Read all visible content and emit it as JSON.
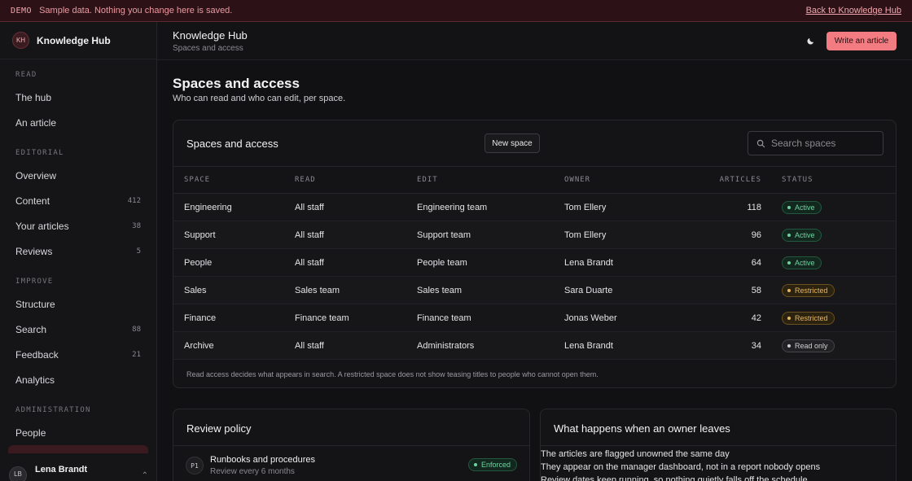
{
  "banner": {
    "tag": "DEMO",
    "message": "Sample data. Nothing you change here is saved.",
    "back_link": "Back to Knowledge Hub"
  },
  "brand": {
    "initials": "KH",
    "name": "Knowledge Hub"
  },
  "sidebar": {
    "sections": [
      {
        "label": "READ",
        "items": [
          {
            "label": "The hub",
            "count": ""
          },
          {
            "label": "An article",
            "count": ""
          }
        ]
      },
      {
        "label": "EDITORIAL",
        "items": [
          {
            "label": "Overview",
            "count": ""
          },
          {
            "label": "Content",
            "count": "412"
          },
          {
            "label": "Your articles",
            "count": "38"
          },
          {
            "label": "Reviews",
            "count": "5"
          }
        ]
      },
      {
        "label": "IMPROVE",
        "items": [
          {
            "label": "Structure",
            "count": ""
          },
          {
            "label": "Search",
            "count": "88"
          },
          {
            "label": "Feedback",
            "count": "21"
          },
          {
            "label": "Analytics",
            "count": ""
          }
        ]
      },
      {
        "label": "ADMINISTRATION",
        "items": [
          {
            "label": "People",
            "count": ""
          }
        ]
      }
    ],
    "user": {
      "initials": "LB",
      "name": "Lena Brandt"
    }
  },
  "header": {
    "title": "Knowledge Hub",
    "subtitle": "Spaces and access",
    "write_label": "Write an article",
    "theme_icon": "moon-icon"
  },
  "page": {
    "title": "Spaces and access",
    "subtitle": "Who can read and who can edit, per space."
  },
  "spaces_card": {
    "title": "Spaces and access",
    "new_label": "New space",
    "search_placeholder": "Search spaces",
    "columns": [
      "SPACE",
      "READ",
      "EDIT",
      "OWNER",
      "ARTICLES",
      "STATUS"
    ],
    "rows": [
      {
        "space": "Engineering",
        "read": "All staff",
        "edit": "Engineering team",
        "owner": "Tom Ellery",
        "articles": "118",
        "status": "Active",
        "status_kind": "active"
      },
      {
        "space": "Support",
        "read": "All staff",
        "edit": "Support team",
        "owner": "Tom Ellery",
        "articles": "96",
        "status": "Active",
        "status_kind": "active"
      },
      {
        "space": "People",
        "read": "All staff",
        "edit": "People team",
        "owner": "Lena Brandt",
        "articles": "64",
        "status": "Active",
        "status_kind": "active"
      },
      {
        "space": "Sales",
        "read": "Sales team",
        "edit": "Sales team",
        "owner": "Sara Duarte",
        "articles": "58",
        "status": "Restricted",
        "status_kind": "restricted"
      },
      {
        "space": "Finance",
        "read": "Finance team",
        "edit": "Finance team",
        "owner": "Jonas Weber",
        "articles": "42",
        "status": "Restricted",
        "status_kind": "restricted"
      },
      {
        "space": "Archive",
        "read": "All staff",
        "edit": "Administrators",
        "owner": "Lena Brandt",
        "articles": "34",
        "status": "Read only",
        "status_kind": "readonly"
      }
    ],
    "note": "Read access decides what appears in search. A restricted space does not show teasing titles to people who cannot open them."
  },
  "review_policy": {
    "title": "Review policy",
    "items": [
      {
        "code": "P1",
        "title": "Runbooks and procedures",
        "subtitle": "Review every 6 months",
        "status": "Enforced"
      }
    ]
  },
  "owner_leaves": {
    "title": "What happens when an owner leaves",
    "points": [
      "The articles are flagged unowned the same day",
      "They appear on the manager dashboard, not in a report nobody opens",
      "Review dates keep running, so nothing quietly falls off the schedule"
    ]
  }
}
